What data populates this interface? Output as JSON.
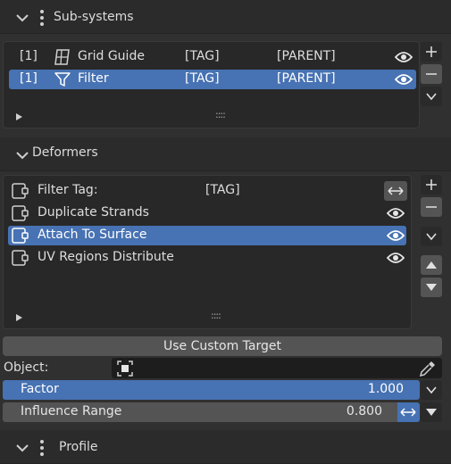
{
  "subsystems": {
    "title": "Sub-systems",
    "items": [
      {
        "index": "[1]",
        "name": "Grid Guide",
        "tag": "[TAG]",
        "parent": "[PARENT]",
        "icon": "grid-guide-icon",
        "selected": false
      },
      {
        "index": "[1]",
        "name": "Filter",
        "tag": "[TAG]",
        "parent": "[PARENT]",
        "icon": "funnel-icon",
        "selected": true
      }
    ],
    "grip": "::::"
  },
  "deformers": {
    "title": "Deformers",
    "items": [
      {
        "name": "Filter Tag:",
        "tag": "[TAG]",
        "selected": false
      },
      {
        "name": "Duplicate Strands",
        "selected": false
      },
      {
        "name": "Attach To Surface",
        "selected": true
      },
      {
        "name": "UV Regions Distribute",
        "selected": false
      }
    ],
    "grip": "::::"
  },
  "use_custom_target": "Use Custom Target",
  "object": {
    "label": "Object:",
    "value": ""
  },
  "factor": {
    "label": "Factor",
    "value": "1.000",
    "fill": 1.0
  },
  "influence_range": {
    "label": "Influence Range",
    "value": "0.800"
  },
  "profile": {
    "title": "Profile"
  },
  "colors": {
    "accent": "#4772b3",
    "background": "#303030",
    "panel": "#282828"
  }
}
